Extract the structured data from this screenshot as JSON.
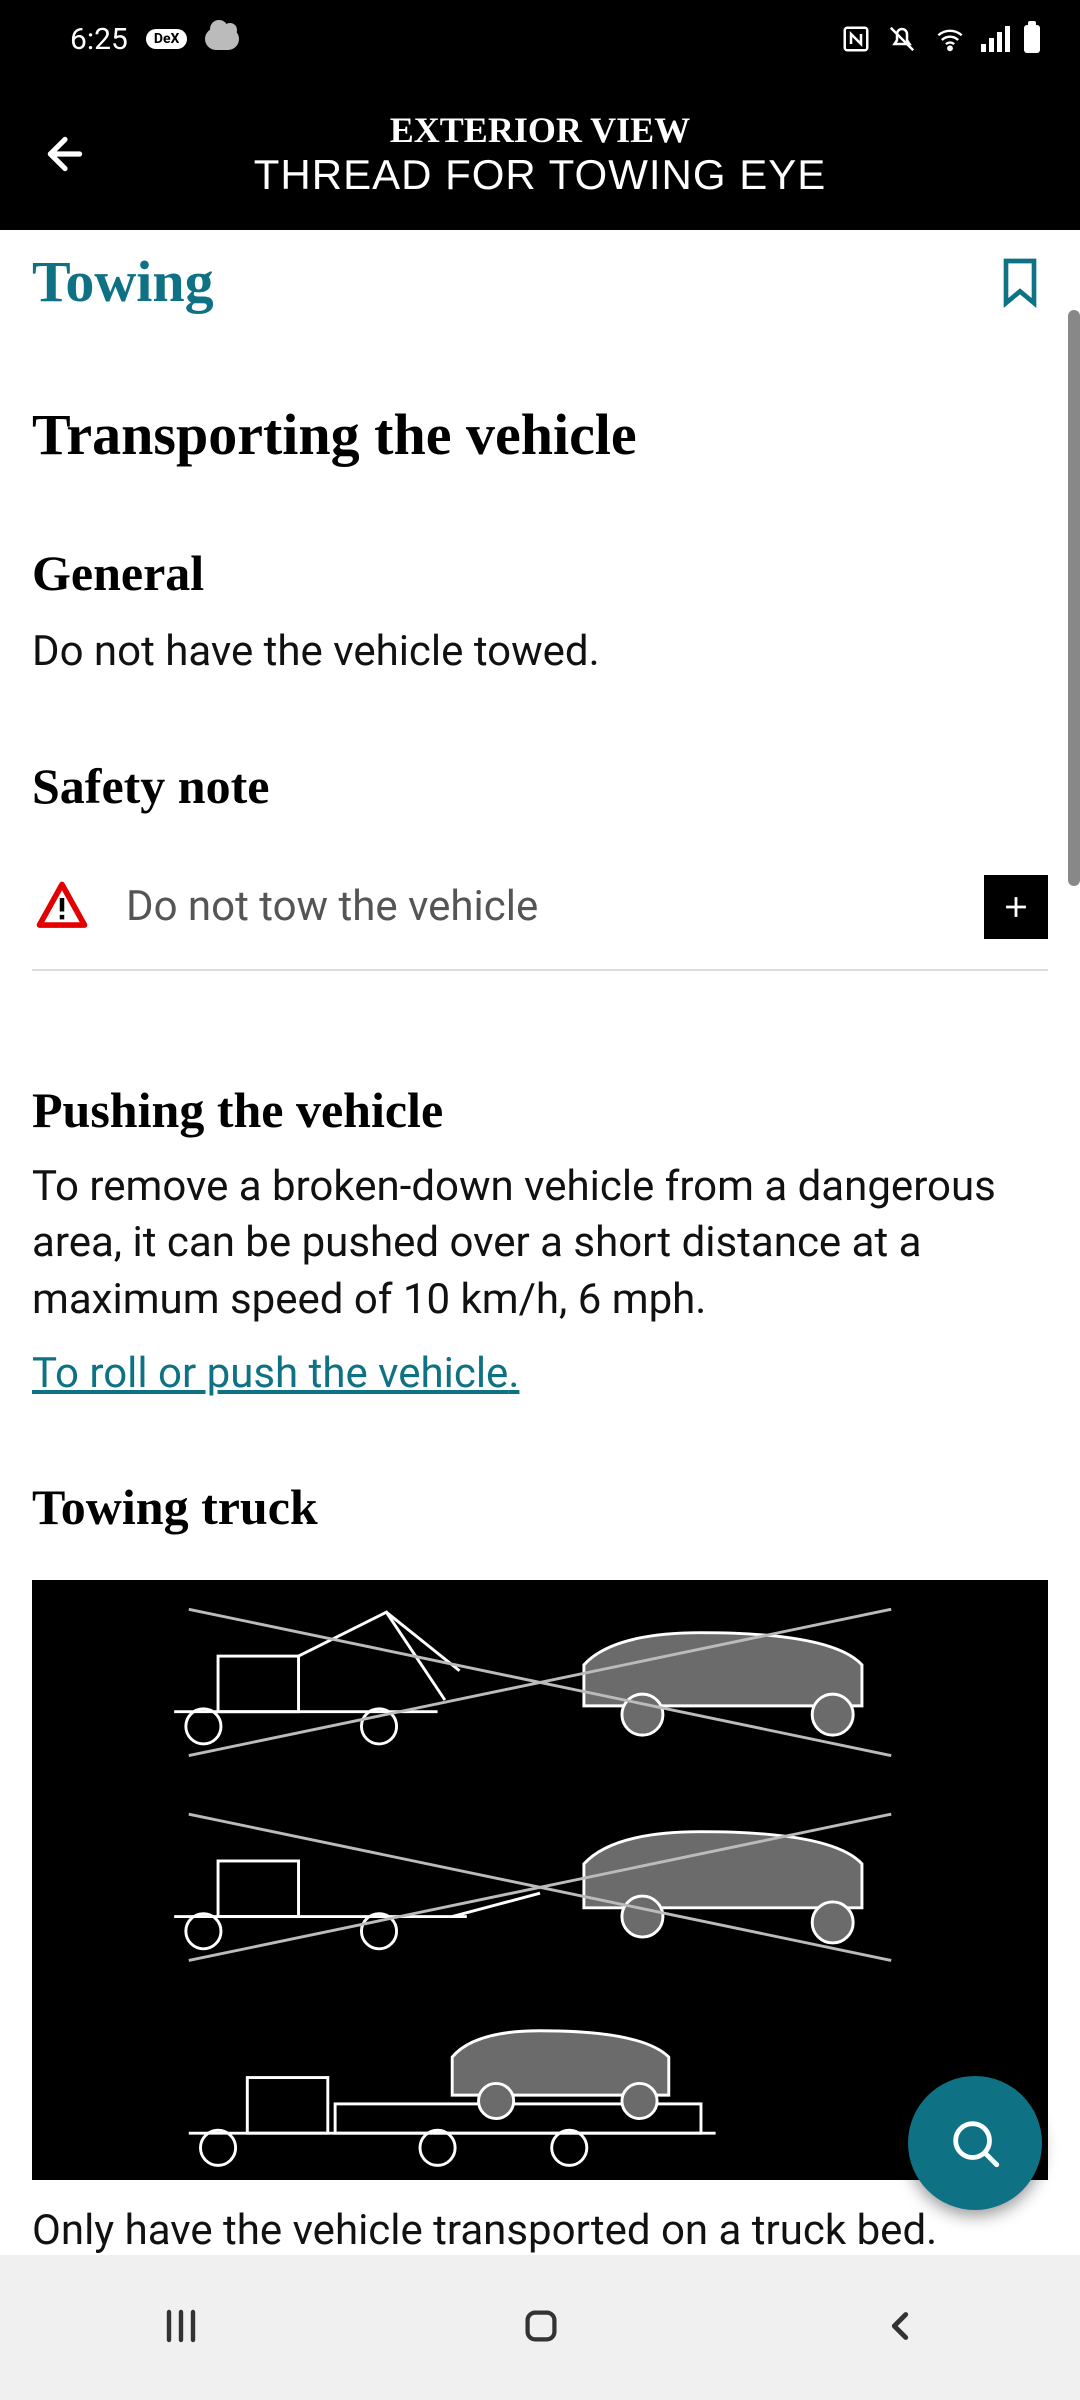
{
  "status": {
    "time": "6:25",
    "dex": "DeX"
  },
  "header": {
    "line1": "EXTERIOR VIEW",
    "line2": "THREAD FOR TOWING EYE"
  },
  "page": {
    "section_link": "Towing",
    "h1": "Transporting the vehicle",
    "general_heading": "General",
    "general_body": "Do not have the vehicle towed.",
    "safety_heading": "Safety note",
    "safety_item": "Do not tow the vehicle",
    "pushing_heading": "Pushing the vehicle",
    "pushing_body": "To remove a broken-down vehicle from a danger­ous area, it can be pushed over a short distance at a maximum speed of 10 km/h, 6 mph.",
    "pushing_link": "To roll or push the vehicle",
    "towing_truck_heading": "Towing truck",
    "towing_caption": "Only have the vehicle transported on a truck bed."
  }
}
